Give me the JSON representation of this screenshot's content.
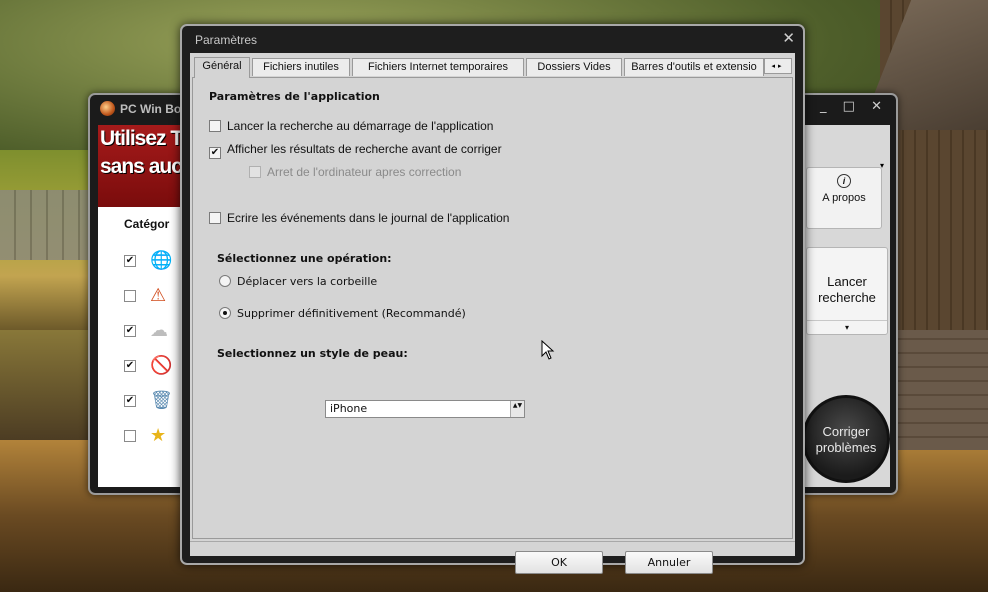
{
  "back_window": {
    "title": "PC Win Boo",
    "window_controls": "_ □ ✕",
    "banner_line1": "Utilisez T",
    "banner_line2": "sans auc",
    "categories_header": "Catégor",
    "rows": [
      {
        "checked": "✔",
        "icon": "🌐"
      },
      {
        "checked": "",
        "icon": "⚠"
      },
      {
        "checked": "✔",
        "icon": "☁"
      },
      {
        "checked": "✔",
        "icon": "🚫"
      },
      {
        "checked": "✔",
        "icon": "🗑"
      },
      {
        "checked": "",
        "icon": "★"
      }
    ],
    "about_label": "A propos",
    "about_icon": "i",
    "dropdown_arrow": "▾",
    "launch_label": "Lancer recherche",
    "fix_label": "Corriger problèmes"
  },
  "dialog": {
    "title": "Paramètres",
    "close_glyph": "✕",
    "tabs": [
      "Général",
      "Fichiers inutiles",
      "Fichiers Internet temporaires",
      "Dossiers Vides",
      "Barres d'outils et extensio"
    ],
    "tab_scroll": "◂▸",
    "app_settings_title": "Paramètres de l'application",
    "options": [
      {
        "label": "Lancer la recherche au démarrage de l'application",
        "checked": ""
      },
      {
        "label": "Afficher les résultats de recherche avant de corriger",
        "checked": "✔"
      },
      {
        "label": "Arret de l'ordinateur apres correction",
        "checked": ""
      },
      {
        "label": "Ecrire les événements dans le journal de l'application",
        "checked": ""
      }
    ],
    "operation_title": "Sélectionnez une opération:",
    "radio_options": [
      {
        "label": "Déplacer vers la corbeille",
        "selected": false
      },
      {
        "label": "Supprimer définitivement (Recommandé)",
        "selected": true
      }
    ],
    "skin_title": "Selectionnez un style de peau:",
    "skin_value": "iPhone",
    "spin_glyph": "▲▼",
    "ok_label": "OK",
    "cancel_label": "Annuler"
  }
}
